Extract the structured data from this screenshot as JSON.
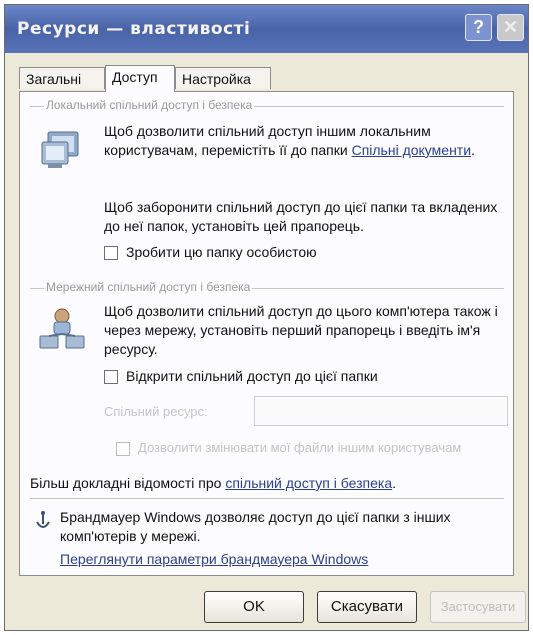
{
  "window": {
    "title": "Ресурси — властивості",
    "help_glyph": "?",
    "close_glyph": "✕"
  },
  "tabs": [
    {
      "label": "Загальні",
      "active": false
    },
    {
      "label": "Доступ",
      "active": true
    },
    {
      "label": "Настройка",
      "active": false
    }
  ],
  "local_group": {
    "title": "Локальний спільний доступ і безпека",
    "text_before_link": "Щоб дозволити спільний доступ іншим локальним користувачам, перемістіть її до папки ",
    "link": "Спільні документи",
    "text_after_link": ".",
    "private_hint": "Щоб заборонити спільний доступ до цієї папки та вкладених до неї папок, установіть цей прапорець.",
    "private_checkbox": "Зробити цю папку особистою",
    "private_checked": false
  },
  "network_group": {
    "title": "Мережний спільний доступ і безпека",
    "hint": "Щоб дозволити спільний доступ до цього комп'ютера також і через мережу, установіть перший прапорець і введіть ім'я ресурсу.",
    "share_checkbox": "Відкрити спільний доступ до цієї папки",
    "share_checked": false,
    "share_name_label": "Спільний ресурс:",
    "share_name_value": "",
    "allow_change_checkbox": "Дозволити змінювати мої файли іншим користувачам",
    "allow_change_checked": false
  },
  "more_info": {
    "prefix": "Більш докладні відомості про ",
    "link": "спільний доступ і безпека",
    "suffix": "."
  },
  "firewall": {
    "text": "Брандмауер Windows дозволяє доступ до цієї папки з інших комп'ютерів у мережі.",
    "link": "Переглянути параметри брандмауера Windows"
  },
  "buttons": {
    "ok": "OK",
    "cancel": "Скасувати",
    "apply": "Застосувати"
  },
  "colors": {
    "titlebar": "#5873b8",
    "link": "#2a3f8f",
    "dialog_bg": "#ece9d8"
  }
}
